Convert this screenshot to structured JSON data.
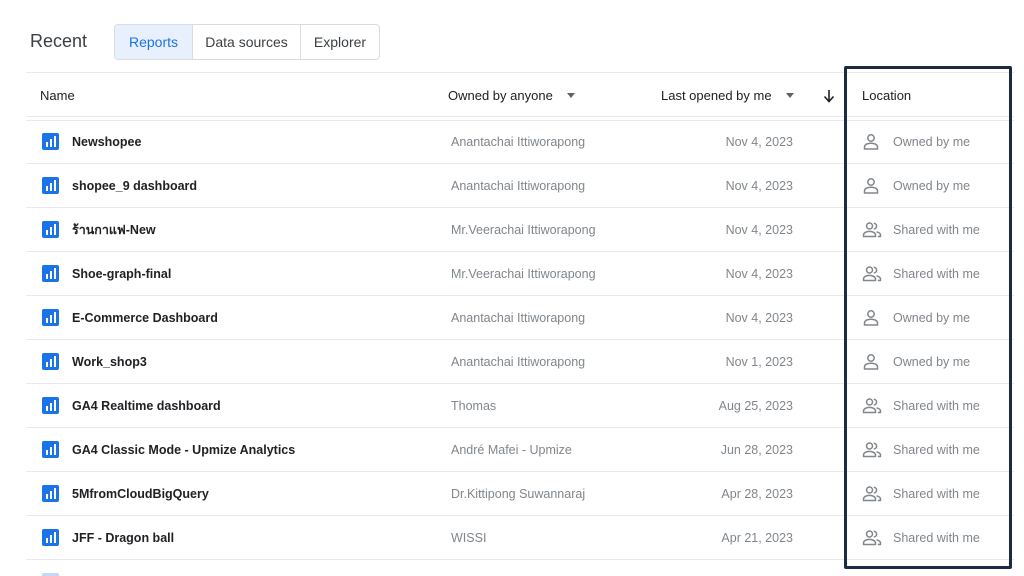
{
  "header": {
    "title": "Recent",
    "tabs": [
      {
        "label": "Reports",
        "active": true
      },
      {
        "label": "Data sources",
        "active": false
      },
      {
        "label": "Explorer",
        "active": false
      }
    ]
  },
  "table": {
    "columns": {
      "name": "Name",
      "owner": "Owned by anyone",
      "date": "Last opened by me",
      "location": "Location"
    },
    "rows": [
      {
        "name": "Newshopee",
        "owner": "Anantachai Ittiworapong",
        "date": "Nov 4, 2023",
        "location": "Owned by me",
        "location_icon": "person-icon"
      },
      {
        "name": "shopee_9 dashboard",
        "owner": "Anantachai Ittiworapong",
        "date": "Nov 4, 2023",
        "location": "Owned by me",
        "location_icon": "person-icon"
      },
      {
        "name": "ร้านกาแฟ-New",
        "owner": "Mr.Veerachai Ittiworapong",
        "date": "Nov 4, 2023",
        "location": "Shared with me",
        "location_icon": "people-icon"
      },
      {
        "name": "Shoe-graph-final",
        "owner": "Mr.Veerachai Ittiworapong",
        "date": "Nov 4, 2023",
        "location": "Shared with me",
        "location_icon": "people-icon"
      },
      {
        "name": "E-Commerce Dashboard",
        "owner": "Anantachai Ittiworapong",
        "date": "Nov 4, 2023",
        "location": "Owned by me",
        "location_icon": "person-icon"
      },
      {
        "name": "Work_shop3",
        "owner": "Anantachai Ittiworapong",
        "date": "Nov 1, 2023",
        "location": "Owned by me",
        "location_icon": "person-icon"
      },
      {
        "name": "GA4 Realtime dashboard",
        "owner": "Thomas",
        "date": "Aug 25, 2023",
        "location": "Shared with me",
        "location_icon": "people-icon"
      },
      {
        "name": "GA4 Classic Mode - Upmize Analytics",
        "owner": "André Mafei - Upmize",
        "date": "Jun 28, 2023",
        "location": "Shared with me",
        "location_icon": "people-icon"
      },
      {
        "name": "5MfromCloudBigQuery",
        "owner": "Dr.Kittipong Suwannaraj",
        "date": "Apr 28, 2023",
        "location": "Shared with me",
        "location_icon": "people-icon"
      },
      {
        "name": "JFF - Dragon ball",
        "owner": "WISSI",
        "date": "Apr 21, 2023",
        "location": "Shared with me",
        "location_icon": "people-icon"
      }
    ]
  },
  "colors": {
    "accent": "#1a73e8",
    "active_tab_bg": "#e8f0fe",
    "highlight_border": "#1c2b44",
    "muted_text": "#80868b"
  }
}
